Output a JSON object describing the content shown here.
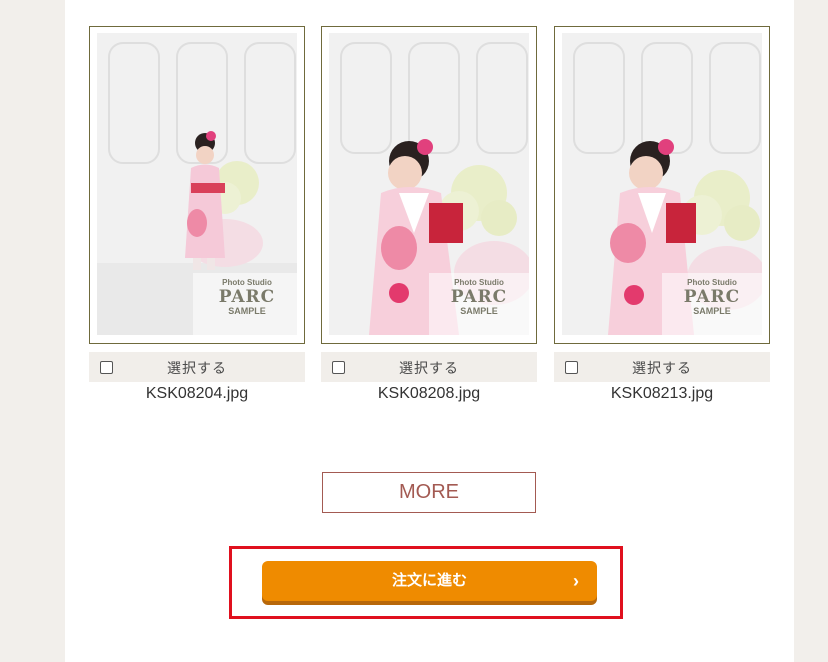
{
  "gallery": {
    "items": [
      {
        "select_label": "選択する",
        "filename": "KSK08204.jpg",
        "watermark_small": "Photo Studio",
        "watermark_brand": "PARC",
        "watermark_sample": "SAMPLE"
      },
      {
        "select_label": "選択する",
        "filename": "KSK08208.jpg",
        "watermark_small": "Photo Studio",
        "watermark_brand": "PARC",
        "watermark_sample": "SAMPLE"
      },
      {
        "select_label": "選択する",
        "filename": "KSK08213.jpg",
        "watermark_small": "Photo Studio",
        "watermark_brand": "PARC",
        "watermark_sample": "SAMPLE"
      }
    ]
  },
  "more_button": {
    "label": "MORE"
  },
  "order_button": {
    "label": "注文に進む",
    "chevron": "›"
  },
  "colors": {
    "page_bg": "#f2efeb",
    "frame_border": "#6f6a3c",
    "more_text": "#a35a52",
    "order_bg": "#ef8b00",
    "highlight": "#e0101e"
  }
}
